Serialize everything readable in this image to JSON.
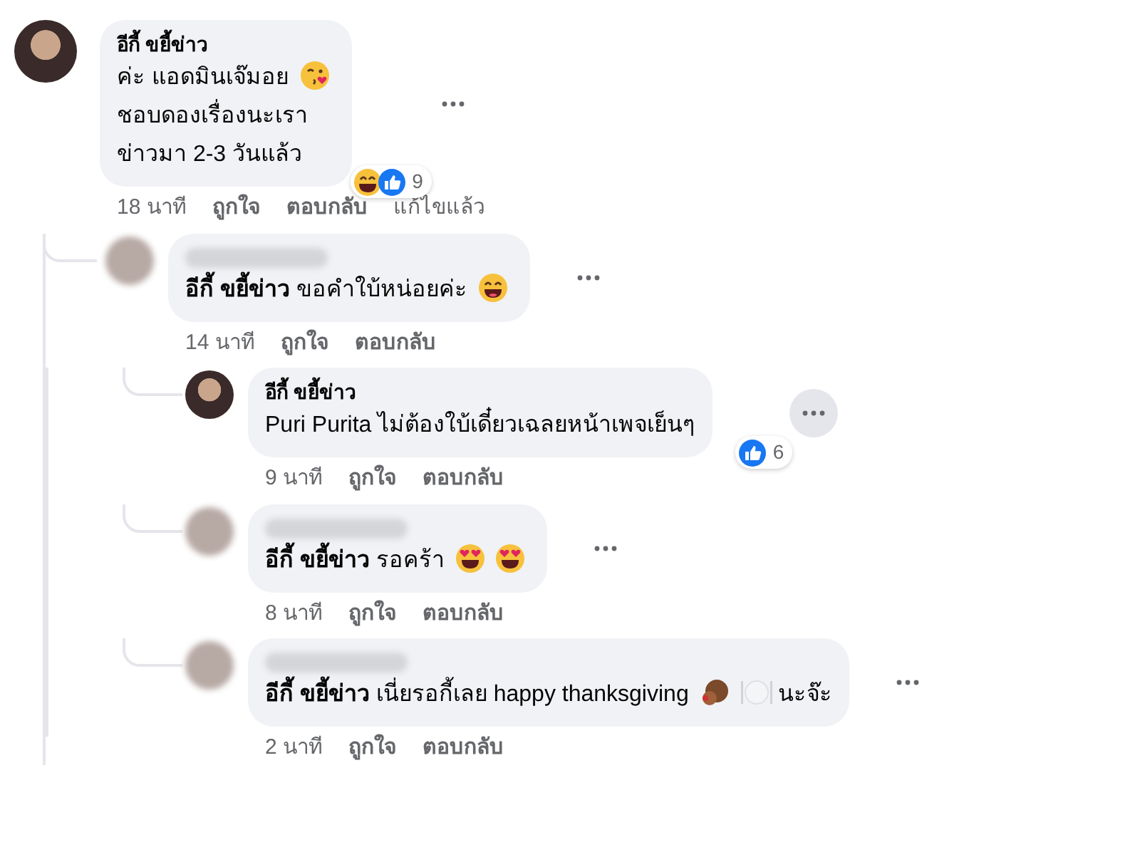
{
  "comments": [
    {
      "author": "อีกี้ ขยี้ข่าว",
      "author_blurred": false,
      "body": [
        {
          "kind": "text",
          "text": "ค่ะ แอดมินเจ๊มอย"
        },
        {
          "kind": "kiss"
        },
        {
          "kind": "break"
        },
        {
          "kind": "text",
          "text": "ชอบดองเรื่องนะเรา"
        },
        {
          "kind": "break"
        },
        {
          "kind": "text",
          "text": "ข่าวมา 2-3 วันแล้ว"
        }
      ],
      "reactions": {
        "items": [
          {
            "kind": "haha"
          },
          {
            "kind": "like"
          }
        ],
        "count": "9"
      },
      "more_highlighted": false,
      "meta": {
        "time": "18 นาที",
        "like": "ถูกใจ",
        "reply": "ตอบกลับ",
        "edited": "แก้ไขแล้ว"
      },
      "children": [
        {
          "author_blurred": true,
          "body": [
            {
              "kind": "mention",
              "text": "อีกี้ ขยี้ข่าว"
            },
            {
              "kind": "text",
              "text": "ขอคำใบ้หน่อยค่ะ"
            },
            {
              "kind": "grin"
            }
          ],
          "more_highlighted": false,
          "meta": {
            "time": "14 นาที",
            "like": "ถูกใจ",
            "reply": "ตอบกลับ"
          },
          "children": [
            {
              "author": "อีกี้ ขยี้ข่าว",
              "author_blurred": false,
              "body": [
                {
                  "kind": "text",
                  "text": "Puri Purita ไม่ต้องใบ้เดี๋ยวเฉลยหน้าเพจเย็นๆ"
                }
              ],
              "reactions": {
                "items": [
                  {
                    "kind": "like"
                  }
                ],
                "count": "6"
              },
              "more_highlighted": true,
              "meta": {
                "time": "9 นาที",
                "like": "ถูกใจ",
                "reply": "ตอบกลับ"
              }
            },
            {
              "author_blurred": true,
              "body": [
                {
                  "kind": "mention",
                  "text": "อีกี้ ขยี้ข่าว"
                },
                {
                  "kind": "text",
                  "text": "รอคร้า"
                },
                {
                  "kind": "heart-eyes"
                },
                {
                  "kind": "heart-eyes"
                }
              ],
              "more_highlighted": false,
              "meta": {
                "time": "8 นาที",
                "like": "ถูกใจ",
                "reply": "ตอบกลับ"
              }
            },
            {
              "author_blurred": true,
              "body": [
                {
                  "kind": "mention",
                  "text": "อีกี้ ขยี้ข่าว"
                },
                {
                  "kind": "text",
                  "text": "เนี่ยรอกี้เลย happy thanksgiving"
                },
                {
                  "kind": "turkey"
                },
                {
                  "kind": "plate"
                },
                {
                  "kind": "text",
                  "text": "นะจ๊ะ"
                }
              ],
              "more_highlighted": false,
              "meta": {
                "time": "2 นาที",
                "like": "ถูกใจ",
                "reply": "ตอบกลับ"
              }
            }
          ]
        }
      ]
    }
  ]
}
